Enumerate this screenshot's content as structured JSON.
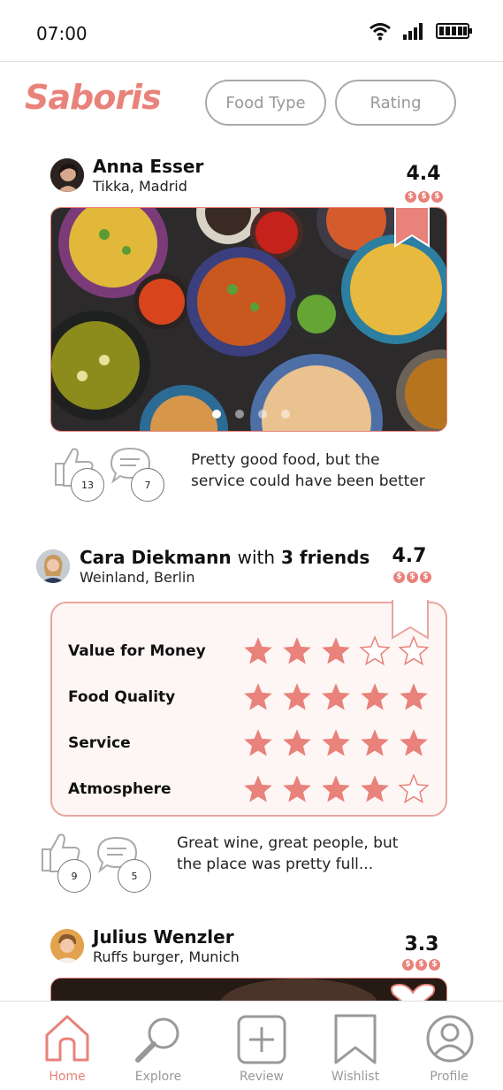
{
  "status": {
    "time": "07:00"
  },
  "header": {
    "logo": "Saboris",
    "filters": [
      "Food Type",
      "Rating"
    ]
  },
  "posts": [
    {
      "user": "Anna Esser",
      "place": "Tikka, Madrid",
      "rating": "4.4",
      "price": "$$$",
      "likes": "13",
      "comments": "7",
      "text_lines": [
        "Pretty good food, but the",
        "service could have been better"
      ],
      "carousel_dots": 4
    },
    {
      "user": "Cara Diekmann",
      "with_text": "with",
      "friends": "3 friends",
      "place": "Weinland, Berlin",
      "rating": "4.7",
      "price": "$$$",
      "likes": "9",
      "comments": "5",
      "text_lines": [
        "Great wine, great people, but",
        "the place was pretty full..."
      ],
      "criteria": [
        {
          "label": "Value for Money",
          "stars": 3
        },
        {
          "label": "Food Quality",
          "stars": 5
        },
        {
          "label": "Service",
          "stars": 5
        },
        {
          "label": "Atmosphere",
          "stars": 4
        }
      ]
    },
    {
      "user": "Julius Wenzler",
      "place": "Ruffs burger, Munich",
      "rating": "3.3",
      "price": "$$$"
    }
  ],
  "nav": [
    "Home",
    "Explore",
    "Review",
    "Wishlist",
    "Profile"
  ],
  "colors": {
    "accent": "#e8827a",
    "muted": "#999999"
  }
}
